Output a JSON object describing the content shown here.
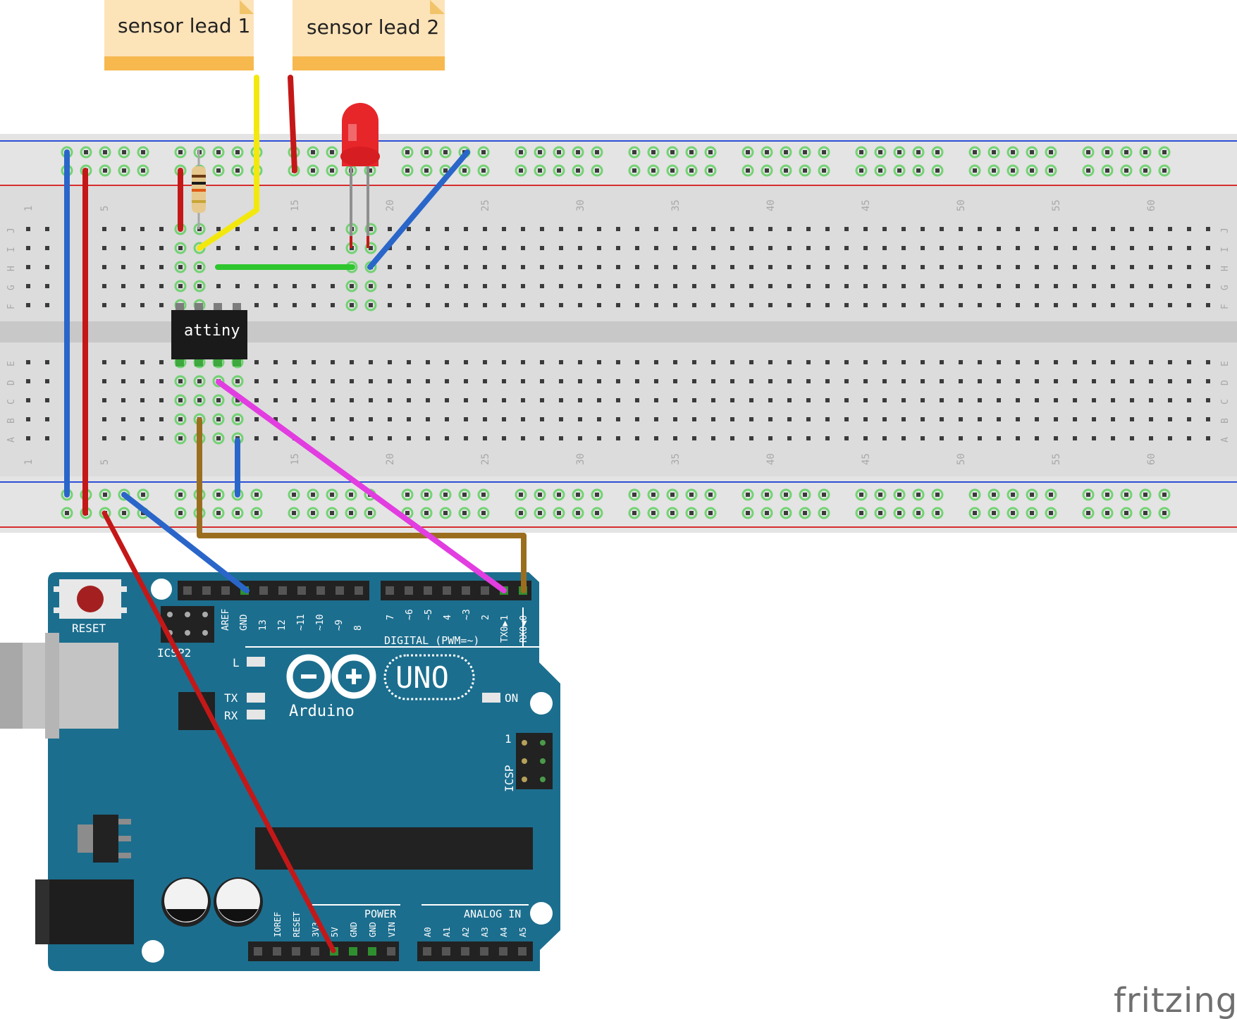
{
  "notes": [
    {
      "id": "note1",
      "text": "sensor lead 1"
    },
    {
      "id": "note2",
      "text": "sensor lead 2"
    }
  ],
  "breadboard": {
    "row_letters_top": [
      "J",
      "I",
      "H",
      "G",
      "F"
    ],
    "row_letters_bottom": [
      "E",
      "D",
      "C",
      "B",
      "A"
    ],
    "column_numbers": [
      "1",
      "5",
      "15",
      "20",
      "25",
      "30",
      "35",
      "40",
      "45",
      "50",
      "55",
      "60"
    ]
  },
  "chip": {
    "label": "attiny"
  },
  "arduino": {
    "reset_label": "RESET",
    "icsp2_label": "ICSP2",
    "led_l_label": "L",
    "led_tx_label": "TX",
    "led_rx_label": "RX",
    "on_label": "ON",
    "brand_label": "Arduino",
    "model_label": "UNO",
    "digital_label": "DIGITAL (PWM=~)",
    "icsp_label": "ICSP",
    "icsp_pin1": "1",
    "power_label": "POWER",
    "analog_label": "ANALOG IN",
    "header_left_pins": [
      "AREF",
      "GND",
      "13",
      "12",
      "~11",
      "~10",
      "~9",
      "8"
    ],
    "header_right_pins": [
      "7",
      "~6",
      "~5",
      "4",
      "~3",
      "2",
      "TX0▶1",
      "RX0◀0"
    ],
    "power_pins": [
      "IOREF",
      "RESET",
      "3V3",
      "5V",
      "GND",
      "GND",
      "VIN"
    ],
    "analog_pins": [
      "A0",
      "A1",
      "A2",
      "A3",
      "A4",
      "A5"
    ]
  },
  "wire_colors": {
    "blue": "#2a66c9",
    "red": "#c41818",
    "yellow": "#f3e80d",
    "green": "#2ec62e",
    "magenta": "#e23de0",
    "brown": "#9b6e1f"
  },
  "board_color": "#1c6e8e",
  "watermark": "fritzing"
}
